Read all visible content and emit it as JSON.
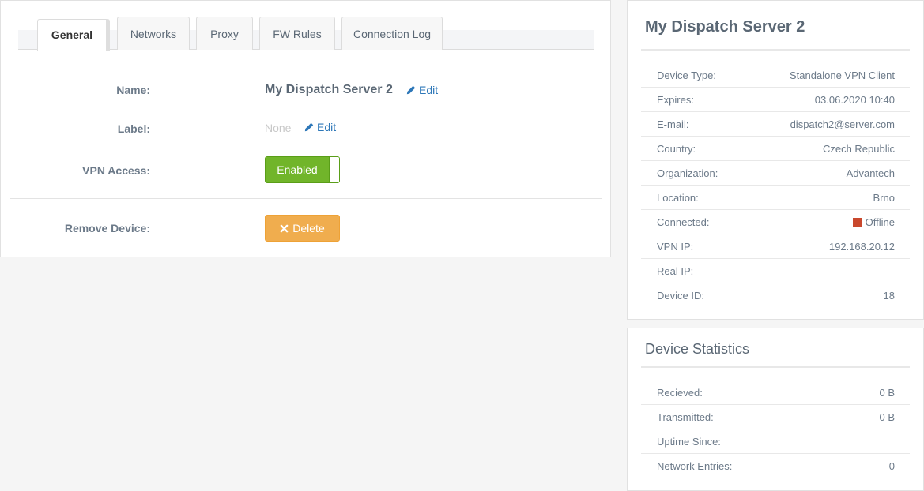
{
  "tabs": [
    {
      "label": "General",
      "active": true
    },
    {
      "label": "Networks",
      "active": false
    },
    {
      "label": "Proxy",
      "active": false
    },
    {
      "label": "FW Rules",
      "active": false
    },
    {
      "label": "Connection Log",
      "active": false
    }
  ],
  "general": {
    "name_label": "Name:",
    "name_value": "My Dispatch Server 2",
    "edit_label": "Edit",
    "label_label": "Label:",
    "label_value": "None",
    "vpn_label": "VPN Access:",
    "vpn_toggle": "Enabled",
    "remove_label": "Remove Device:",
    "delete_label": "Delete"
  },
  "device_info": {
    "title": "My Dispatch Server 2",
    "rows": [
      {
        "key": "Device Type:",
        "value": "Standalone VPN Client"
      },
      {
        "key": "Expires:",
        "value": "03.06.2020 10:40"
      },
      {
        "key": "E-mail:",
        "value": "dispatch2@server.com"
      },
      {
        "key": "Country:",
        "value": "Czech Republic"
      },
      {
        "key": "Organization:",
        "value": "Advantech"
      },
      {
        "key": "Location:",
        "value": "Brno"
      },
      {
        "key": "Connected:",
        "value": "Offline"
      },
      {
        "key": "VPN IP:",
        "value": "192.168.20.12"
      },
      {
        "key": "Real IP:",
        "value": ""
      },
      {
        "key": "Device ID:",
        "value": "18"
      }
    ]
  },
  "device_stats": {
    "title": "Device Statistics",
    "rows": [
      {
        "key": "Recieved:",
        "value": "0 B"
      },
      {
        "key": "Transmitted:",
        "value": "0 B"
      },
      {
        "key": "Uptime Since:",
        "value": ""
      },
      {
        "key": "Network Entries:",
        "value": "0"
      }
    ]
  },
  "colors": {
    "accent_link": "#2d77b8",
    "toggle_green": "#71b52a",
    "delete_orange": "#f0ad4e",
    "offline_status": "#c9482d"
  },
  "icons": {
    "edit": "pencil-icon",
    "delete": "times-icon",
    "offline": "status-square-icon"
  }
}
